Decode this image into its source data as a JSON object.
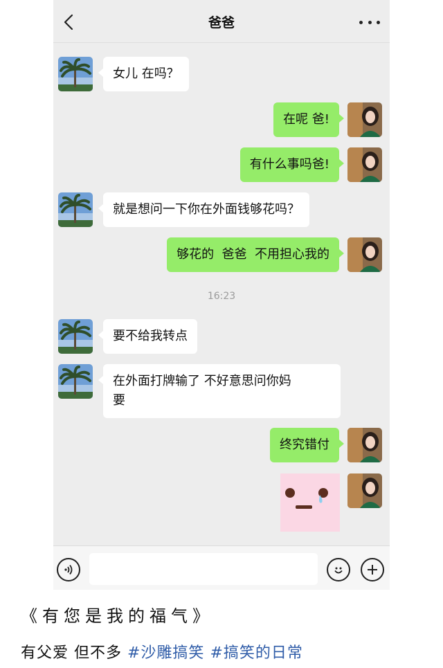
{
  "header": {
    "title": "爸爸",
    "back_icon": "chevron-left-icon",
    "more_icon": "more-dots-icon"
  },
  "messages": [
    {
      "side": "in",
      "text": "女儿 在吗？"
    },
    {
      "side": "out",
      "text": "在呢 爸!"
    },
    {
      "side": "out",
      "text": "有什么事吗爸!"
    },
    {
      "side": "in",
      "text": "就是想问一下你在外面钱够花吗？"
    },
    {
      "side": "out",
      "text": "够花的  爸爸  不用担心我的"
    },
    {
      "side": "in",
      "text": "要不给我转点"
    },
    {
      "side": "in",
      "text": "在外面打牌输了 不好意思问你妈\n要"
    },
    {
      "side": "out",
      "text": "终究错付"
    },
    {
      "side": "out",
      "type": "sticker",
      "sticker_icon": "crying-face-sticker-icon"
    }
  ],
  "timestamp": "16:23",
  "input_bar": {
    "voice_icon": "voice-icon",
    "emoji_icon": "emoji-icon",
    "plus_icon": "plus-icon",
    "text_value": ""
  },
  "caption": {
    "line1": "《有您是我的福气》",
    "line2_prefix": "有父爱 但不多 ",
    "tags": [
      "#沙雕搞笑",
      "#搞笑的日常"
    ]
  },
  "colors": {
    "chat_background": "#ededed",
    "incoming_bubble": "#ffffff",
    "outgoing_bubble": "#95ec69",
    "hashtag": "#2f5ca8"
  }
}
